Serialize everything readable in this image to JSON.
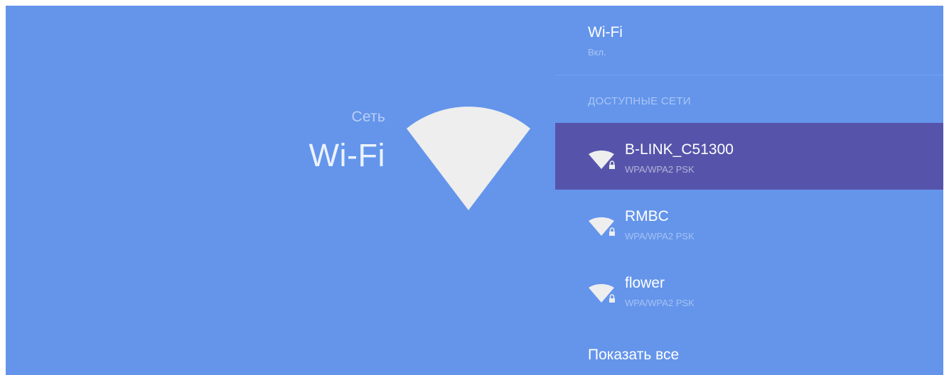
{
  "left": {
    "breadcrumb": "Сеть",
    "title": "Wi-Fi"
  },
  "wifi_toggle": {
    "title": "Wi-Fi",
    "status": "Вкл."
  },
  "section_header": "ДОСТУПНЫЕ СЕТИ",
  "networks": [
    {
      "name": "B-LINK_C51300",
      "security": "WPA/WPA2 PSK",
      "selected": true,
      "icon": "wifi-lock-icon"
    },
    {
      "name": "RMBC",
      "security": "WPA/WPA2 PSK",
      "selected": false,
      "icon": "wifi-lock-icon"
    },
    {
      "name": "flower",
      "security": "WPA/WPA2 PSK",
      "selected": false,
      "icon": "wifi-lock-icon"
    }
  ],
  "show_all": "Показать все",
  "colors": {
    "background": "#6495eb",
    "selected_row": "#5654aa",
    "icon_fill": "#eeeeee"
  }
}
